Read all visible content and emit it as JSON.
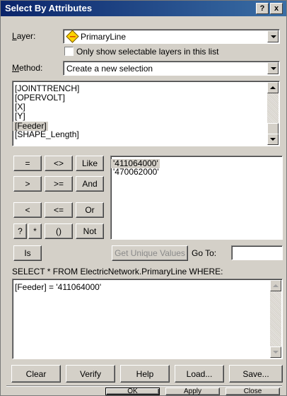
{
  "window": {
    "title": "Select By Attributes",
    "help_btn": "?",
    "close_btn": "x"
  },
  "layer": {
    "label": "Layer:",
    "value": "PrimaryLine",
    "icon": "layer-diamond-icon"
  },
  "only_selectable": {
    "label": "Only show selectable layers in this list",
    "checked": false
  },
  "method": {
    "label": "Method:",
    "value": "Create a new selection"
  },
  "fields": [
    "[JOINTTRENCH]",
    "[OPERVOLT]",
    "[X]",
    "[Y]",
    "[Feeder]",
    "[SHAPE_Length]"
  ],
  "fields_selected": "[Feeder]",
  "operators": {
    "eq": "=",
    "ne": "<>",
    "like": "Like",
    "gt": ">",
    "ge": ">=",
    "and": "And",
    "lt": "<",
    "le": "<=",
    "or": "Or",
    "q": "?",
    "star": "*",
    "paren": "()",
    "not": "Not",
    "is": "Is"
  },
  "values": [
    "'411064000'",
    "'470062000'"
  ],
  "values_selected": "'411064000'",
  "get_unique_values": "Get Unique Values",
  "goto": {
    "label": "Go To:",
    "value": ""
  },
  "query_header": "SELECT * FROM ElectricNetwork.PrimaryLine WHERE:",
  "query_text": "[Feeder] = '411064000'",
  "bottom_buttons": {
    "clear": "Clear",
    "verify": "Verify",
    "help": "Help",
    "load": "Load...",
    "save": "Save..."
  },
  "dialog_buttons": {
    "ok": "OK",
    "apply": "Apply",
    "close": "Close"
  }
}
